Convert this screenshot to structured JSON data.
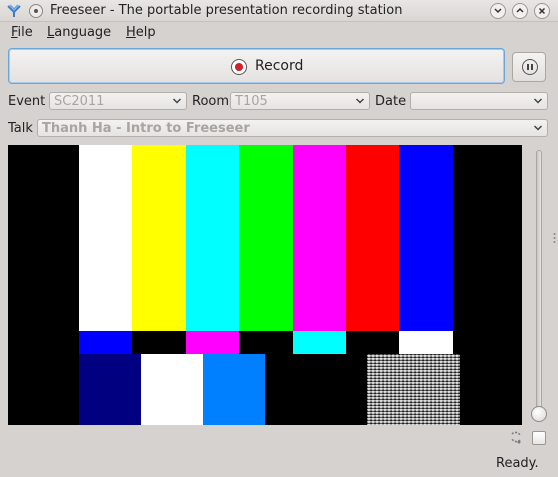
{
  "window": {
    "title": "Freeseer - The portable presentation recording station",
    "controls": [
      "chevron-down",
      "chevron-up",
      "close"
    ]
  },
  "menu": {
    "file": {
      "mnemonic": "F",
      "rest": "ile"
    },
    "language": {
      "mnemonic": "L",
      "rest": "anguage"
    },
    "help": {
      "mnemonic": "H",
      "rest": "elp"
    }
  },
  "toolbar": {
    "record_label": "Record",
    "pause_icon": "pause-icon"
  },
  "selectors": {
    "event_label": "Event",
    "event_value": "SC2011",
    "room_label": "Room",
    "room_value": "T105",
    "date_label": "Date",
    "date_value": "",
    "talk_label": "Talk",
    "talk_value": "Thanh Ha - Intro to Freeseer"
  },
  "colors": {
    "accent_border": "#6aa6d8",
    "record_red": "#d0202a",
    "disabled_text": "#a8a4a0"
  },
  "preview": {
    "pattern": "smpte-color-bars",
    "top_bars": [
      "#ffffff",
      "#ffff00",
      "#00ffff",
      "#00ff00",
      "#ff00ff",
      "#ff0000",
      "#0000ff"
    ],
    "middle_bars": [
      "#0000ff",
      "#000000",
      "#ff00ff",
      "#000000",
      "#00ffff",
      "#000000",
      "#ffffff"
    ],
    "bottom_bars": [
      "#000080",
      "#ffffff",
      "#0080ff",
      "#000000",
      "#000000",
      "#111111",
      "noise"
    ]
  },
  "volume": {
    "level": 0.0
  },
  "status": {
    "text": "Ready."
  }
}
